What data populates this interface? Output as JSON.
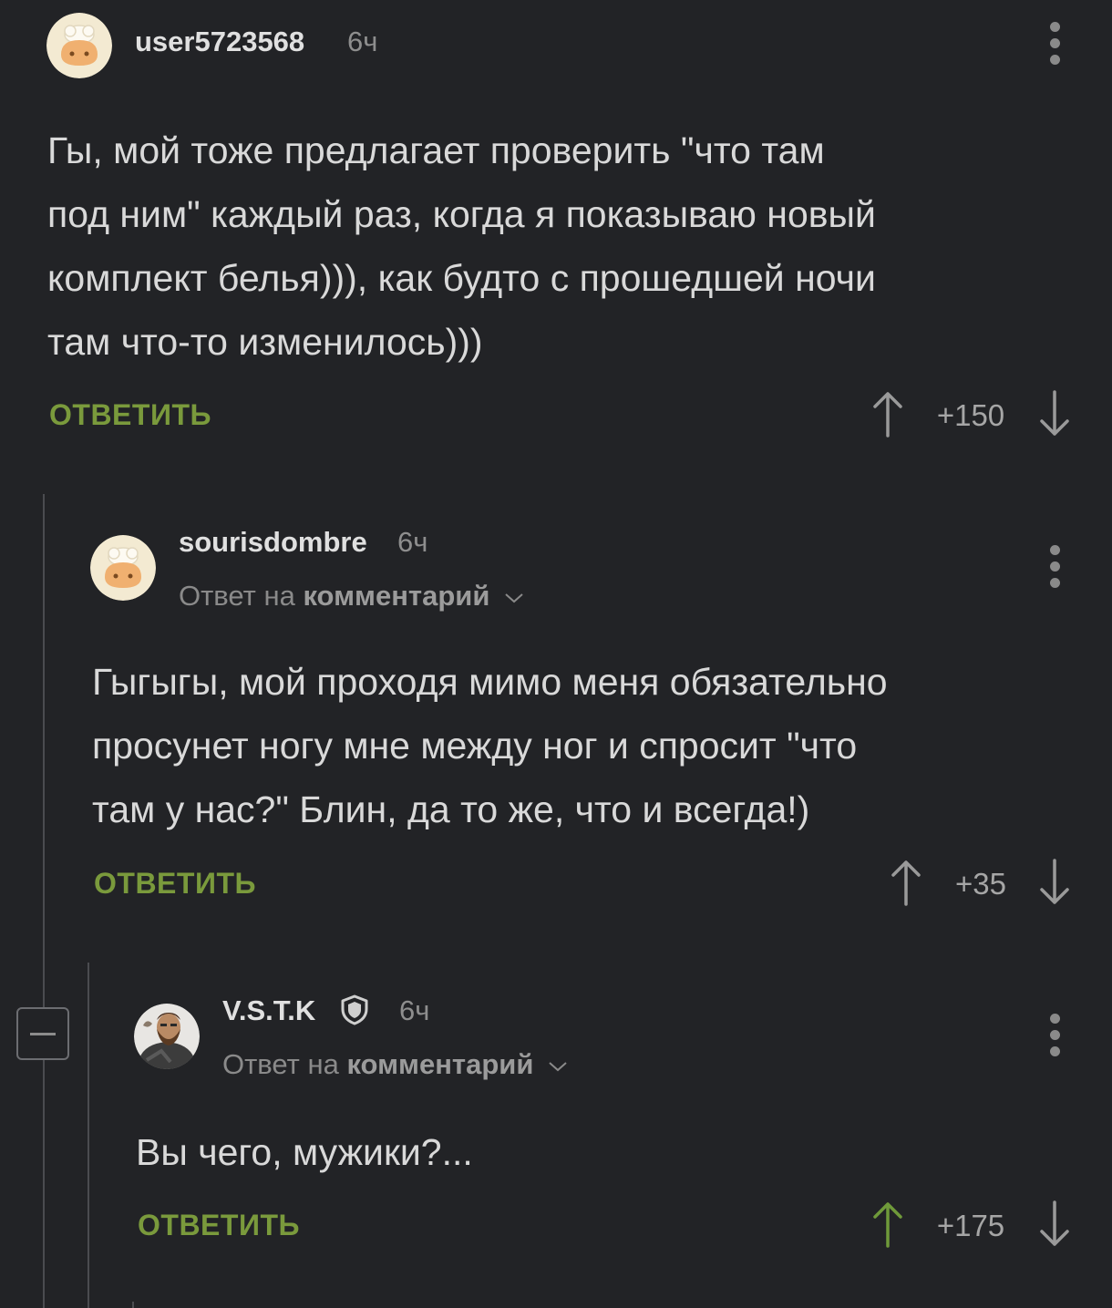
{
  "comments": [
    {
      "username": "user5723568",
      "time": "6ч",
      "text_lines": [
        "Гы, мой тоже предлагает проверить \"что там",
        "под ним\" каждый раз, когда я показываю новый",
        "комплект белья))), как будто с прошедшей ночи",
        "там что-то изменилось)))"
      ],
      "reply_label": "ОТВЕТИТЬ",
      "rating": "+150",
      "upvote_state": "neutral"
    },
    {
      "username": "sourisdombre",
      "time": "6ч",
      "reply_to_prefix": "Ответ на",
      "reply_to_link": "комментарий",
      "text_lines": [
        "Гыгыгы, мой проходя мимо меня обязательно",
        "просунет ногу мне между ног и спросит \"что",
        "там у нас?\" Блин, да то же, что и всегда!)"
      ],
      "reply_label": "ОТВЕТИТЬ",
      "rating": "+35",
      "upvote_state": "neutral"
    },
    {
      "username": "V.S.T.K",
      "badge": "shield-icon",
      "time": "6ч",
      "reply_to_prefix": "Ответ на",
      "reply_to_link": "комментарий",
      "text_lines": [
        "Вы чего, мужики?..."
      ],
      "reply_label": "ОТВЕТИТЬ",
      "rating": "+175",
      "upvote_state": "upvoted"
    }
  ],
  "colors": {
    "background": "#222326",
    "accent_green": "#7a9a3c",
    "upvoted_arrow": "#6f9a3a",
    "text": "#d9d9d9",
    "muted": "#8e8e8e"
  }
}
